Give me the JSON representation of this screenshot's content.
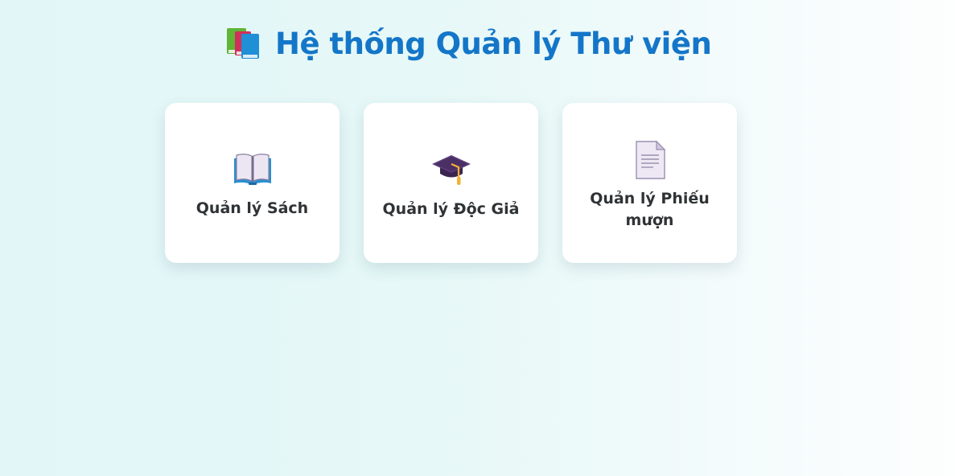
{
  "header": {
    "title": "Hệ thống Quản lý Thư viện",
    "icon": "books-icon"
  },
  "cards": [
    {
      "label": "Quản lý Sách",
      "icon": "open-book-icon"
    },
    {
      "label": "Quản lý Độc Giả",
      "icon": "graduation-cap-icon"
    },
    {
      "label": "Quản lý Phiếu mượn",
      "icon": "document-icon"
    }
  ],
  "colors": {
    "title": "#1476c8",
    "card_text": "#2f3335",
    "card_background": "#ffffff",
    "page_background": "#e6f8f7"
  }
}
